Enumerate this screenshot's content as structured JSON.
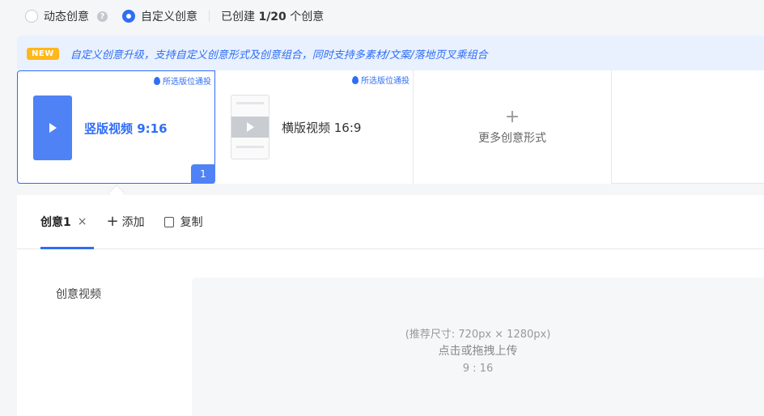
{
  "mode": {
    "dynamic_label": "动态创意",
    "custom_label": "自定义创意",
    "count_prefix": "已创建 ",
    "count_value": "1/20",
    "count_suffix": " 个创意",
    "selected": "custom"
  },
  "notice": {
    "badge": "NEW",
    "text": "自定义创意升级，支持自定义创意形式及创意组合，同时支持多素材/文案/落地页叉乘组合"
  },
  "formats": [
    {
      "tag": "所选版位通投",
      "label": "竖版视频 9:16",
      "selected": true,
      "count": "1"
    },
    {
      "tag": "所选版位通投",
      "label": "横版视频 16:9",
      "selected": false
    },
    {
      "label": "更多创意形式"
    }
  ],
  "tabs": {
    "active": "创意1",
    "close": "×",
    "add_label": "添加",
    "copy_label": "复制"
  },
  "field": {
    "label": "创意视频"
  },
  "upload": {
    "hint": "(推荐尺寸: 720px × 1280px)",
    "main": "点击或拖拽上传",
    "ratio": "9 : 16"
  },
  "colors": {
    "accent": "#2f6ef5",
    "badge": "#ffb71b"
  }
}
